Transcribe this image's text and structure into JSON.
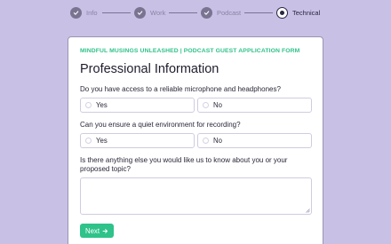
{
  "stepper": {
    "steps": [
      {
        "label": "Info",
        "state": "done"
      },
      {
        "label": "Work",
        "state": "done"
      },
      {
        "label": "Podcast",
        "state": "done"
      },
      {
        "label": "Technical",
        "state": "current"
      }
    ]
  },
  "form": {
    "brand": "MINDFUL MUSINGS UNLEASHED | PODCAST GUEST APPLICATION FORM",
    "title": "Professional Information",
    "questions": [
      {
        "label": "Do you have access to a reliable microphone and headphones?",
        "options": [
          "Yes",
          "No"
        ]
      },
      {
        "label": "Can you ensure a quiet environment for recording?",
        "options": [
          "Yes",
          "No"
        ]
      },
      {
        "label": "Is there anything else you would like us to know about you or your proposed topic?",
        "value": ""
      }
    ],
    "next_label": "Next",
    "next_icon": "arrow-right-icon"
  },
  "colors": {
    "background": "#c9c0e6",
    "accent": "#2fc28a",
    "step_done": "#7a7491"
  }
}
